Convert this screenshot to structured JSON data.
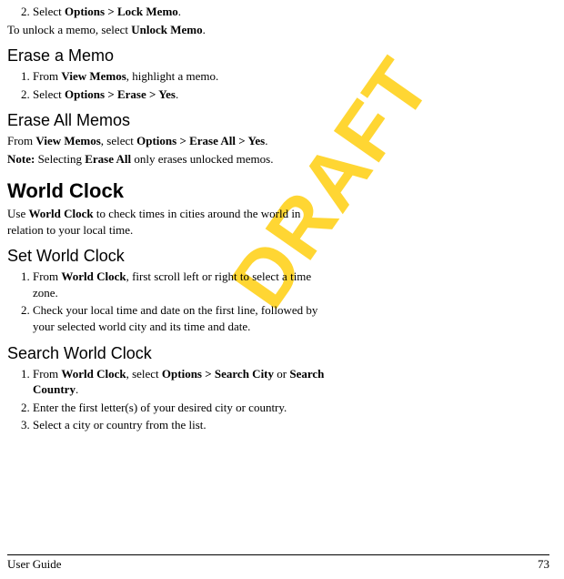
{
  "watermark": "DRAFT",
  "s1": {
    "step2_a": "Select ",
    "step2_b": "Options > Lock Memo",
    "step2_c": ".",
    "after_a": "To unlock a memo, select ",
    "after_b": "Unlock Memo",
    "after_c": "."
  },
  "erase_memo": {
    "heading": "Erase a Memo",
    "step1_a": "From ",
    "step1_b": "View Memos",
    "step1_c": ", highlight a memo.",
    "step2_a": "Select ",
    "step2_b": "Options > Erase > Yes",
    "step2_c": "."
  },
  "erase_all": {
    "heading": "Erase All Memos",
    "p_a": "From ",
    "p_b": "View Memos",
    "p_c": ", select ",
    "p_d": "Options > Erase All > Yes",
    "p_e": ".",
    "note_a": "Note:",
    "note_b": " Selecting ",
    "note_c": "Erase All",
    "note_d": " only erases unlocked memos."
  },
  "world": {
    "heading": "World Clock",
    "intro_a": "Use ",
    "intro_b": "World Clock",
    "intro_c": " to check times in cities around the world in relation to your local time."
  },
  "set": {
    "heading": "Set World Clock",
    "step1_a": "From ",
    "step1_b": "World Clock",
    "step1_c": ", first scroll left or right to select a time zone.",
    "step2": "Check your local time and date on the first line, followed by your selected world city and its time and date."
  },
  "search": {
    "heading": "Search World Clock",
    "step1_a": "From ",
    "step1_b": "World Clock",
    "step1_c": ", select ",
    "step1_d": "Options > Search City",
    "step1_e": " or ",
    "step1_f": "Search Country",
    "step1_g": ".",
    "step2": "Enter the first letter(s) of your desired city or country.",
    "step3": "Select a city or country from the list."
  },
  "footer": {
    "left": "User Guide",
    "right": "73"
  }
}
